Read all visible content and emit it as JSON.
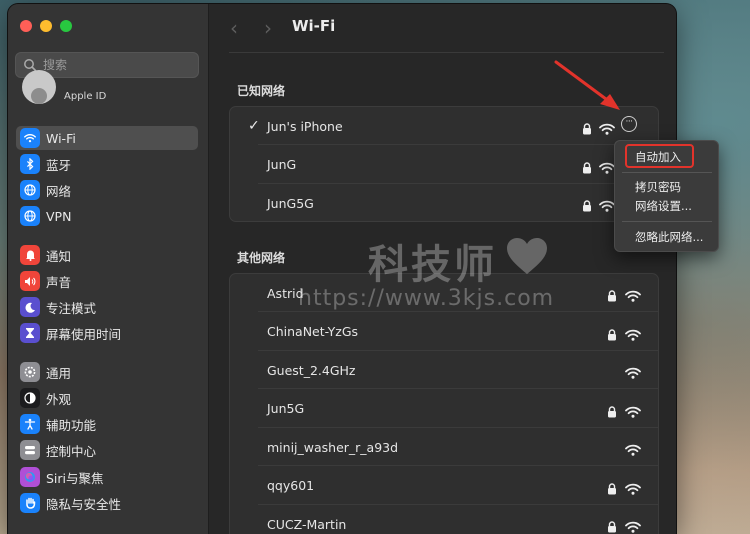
{
  "sidebar": {
    "search_placeholder": "搜索",
    "account_label": "Apple ID",
    "items": [
      {
        "label": "Wi-Fi",
        "icon": "wifi-icon",
        "color": "#1a82fb",
        "active": true
      },
      {
        "label": "蓝牙",
        "icon": "bluetooth-icon",
        "color": "#1a82fb"
      },
      {
        "label": "网络",
        "icon": "globe-icon",
        "color": "#1a82fb"
      },
      {
        "label": "VPN",
        "icon": "vpn-globe-icon",
        "color": "#1a82fb"
      },
      {
        "label": "通知",
        "icon": "bell-icon",
        "color": "#f0453a"
      },
      {
        "label": "声音",
        "icon": "speaker-icon",
        "color": "#f0453a"
      },
      {
        "label": "专注模式",
        "icon": "moon-icon",
        "color": "#5a4fcf"
      },
      {
        "label": "屏幕使用时间",
        "icon": "hourglass-icon",
        "color": "#5a4fcf"
      },
      {
        "label": "通用",
        "icon": "gear-icon",
        "color": "#8e8e93"
      },
      {
        "label": "外观",
        "icon": "appearance-icon",
        "color": "#1c1c1e"
      },
      {
        "label": "辅助功能",
        "icon": "accessibility-icon",
        "color": "#1a82fb"
      },
      {
        "label": "控制中心",
        "icon": "control-center-icon",
        "color": "#8e8e93"
      },
      {
        "label": "Siri与聚焦",
        "icon": "siri-icon",
        "color": "#b04fd6"
      },
      {
        "label": "隐私与安全性",
        "icon": "hand-icon",
        "color": "#1a82fb"
      }
    ]
  },
  "header": {
    "back_glyph": "‹",
    "forward_glyph": "›",
    "title": "Wi-Fi"
  },
  "known_networks": {
    "title": "已知网络",
    "items": [
      {
        "name": "Jun's iPhone",
        "connected": true,
        "check": "✓",
        "locked": true
      },
      {
        "name": "JunG",
        "connected": false,
        "locked": true
      },
      {
        "name": "JunG5G",
        "connected": false,
        "locked": true
      }
    ]
  },
  "other_networks": {
    "title": "其他网络",
    "items": [
      {
        "name": "Astrid",
        "locked": true
      },
      {
        "name": "ChinaNet-YzGs",
        "locked": true
      },
      {
        "name": "Guest_2.4GHz",
        "locked": false
      },
      {
        "name": "Jun5G",
        "locked": true
      },
      {
        "name": "minij_washer_r_a93d",
        "locked": false
      },
      {
        "name": "qqy601",
        "locked": true
      },
      {
        "name": "CUCZ-Martin",
        "locked": true
      }
    ]
  },
  "more_button": {
    "glyph": "···"
  },
  "context_menu": {
    "items": [
      "自动加入",
      "拷贝密码",
      "网络设置...",
      "忽略此网络..."
    ],
    "highlighted": "自动加入",
    "highlight_color": "#e2332b"
  },
  "watermark": {
    "title": "科技师",
    "url": "https://www.3kjs.com"
  },
  "colors": {
    "accent": "#1a82fb",
    "annotation_red": "#e2332b"
  }
}
